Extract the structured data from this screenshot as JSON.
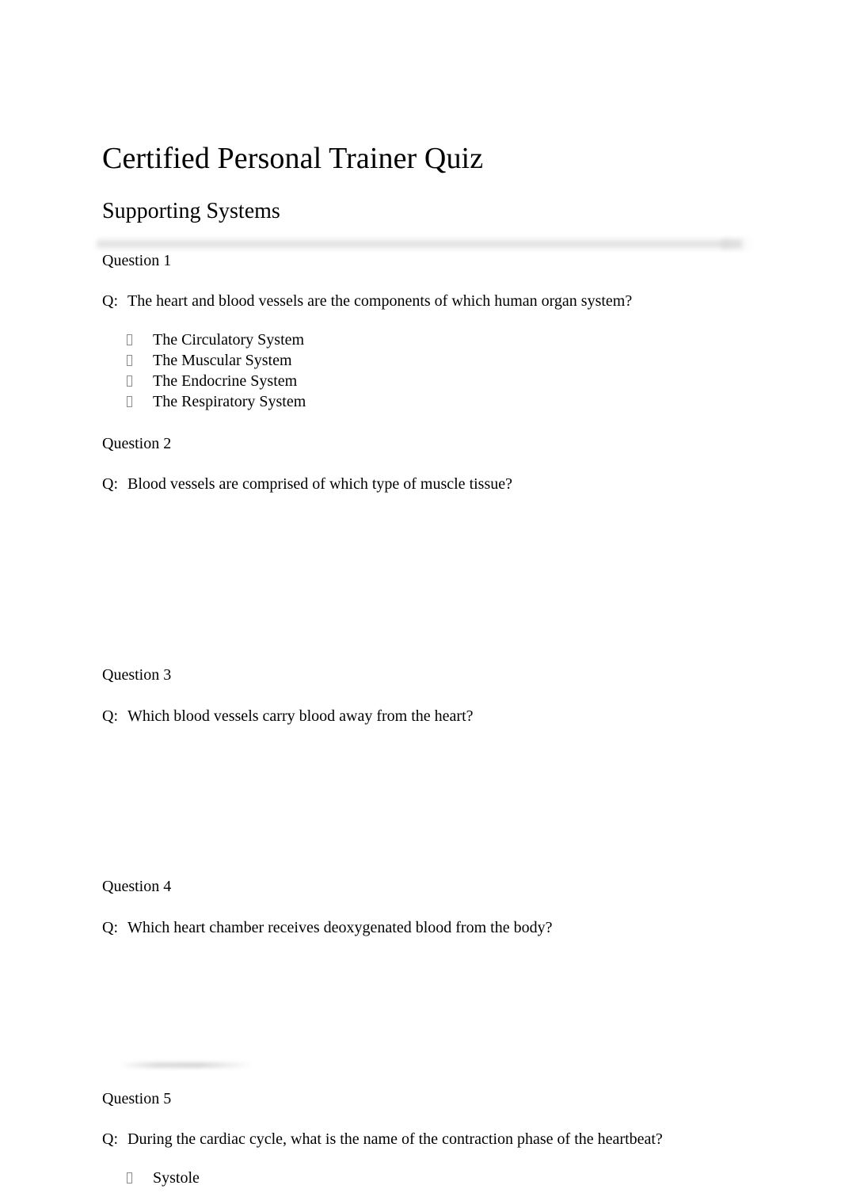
{
  "document": {
    "title": "Certified Personal Trainer Quiz",
    "subtitle": "Supporting Systems"
  },
  "questions": [
    {
      "label": "Question 1",
      "prefix": "Q:",
      "text": "The heart and blood vessels are the components of which human organ system?",
      "options": [
        "The Circulatory System",
        "The Muscular System",
        "The Endocrine System",
        "The Respiratory System"
      ]
    },
    {
      "label": "Question 2",
      "prefix": "Q:",
      "text": "Blood vessels are comprised of which type of muscle tissue?",
      "options": []
    },
    {
      "label": "Question 3",
      "prefix": "Q:",
      "text": "Which blood vessels carry blood away from the heart?",
      "options": []
    },
    {
      "label": "Question 4",
      "prefix": "Q:",
      "text": "Which heart chamber receives deoxygenated blood from the body?",
      "options": []
    },
    {
      "label": "Question 5",
      "prefix": "Q:",
      "text": "During the cardiac cycle, what is the name of the contraction phase of the heartbeat?",
      "options": [
        "Systole"
      ]
    }
  ],
  "colors": {
    "page_background": "#ffffff",
    "text": "#000000",
    "band_gray": "#cdcdcd",
    "bullet_outline": "#8a8a8a"
  }
}
